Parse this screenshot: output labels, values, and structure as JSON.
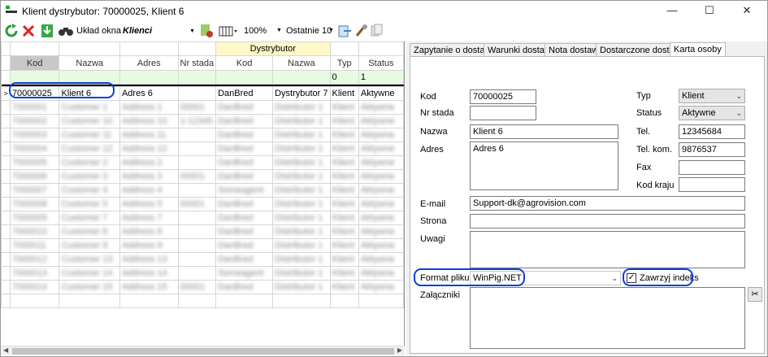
{
  "window": {
    "title": "Klient dystrybutor: 70000025, Klient 6",
    "minimize": "—",
    "maximize": "☐",
    "close": "✕"
  },
  "toolbar": {
    "layout_label": "Układ okna",
    "layout_value": "Klienci",
    "zoom": "100%",
    "recent": "Ostatnie 10"
  },
  "grid": {
    "group_header": "Dystrybutor",
    "columns": [
      "Kod",
      "Nazwa",
      "Adres",
      "Nr stada",
      "Kod",
      "Nazwa",
      "Typ",
      "Status"
    ],
    "filter": [
      "",
      "",
      "",
      "",
      "",
      "",
      "0",
      "1"
    ],
    "selected_row": [
      "70000025",
      "Klient 6",
      "Adres 6",
      "",
      "DanBred",
      "Dystrybutor 7",
      "Klient",
      "Aktywne"
    ],
    "blurred_rows": [
      [
        "7000001",
        "Customer 1",
        "Address 1",
        "00001",
        "DanBred",
        "Distributor 1",
        "Klient",
        "Aktywne"
      ],
      [
        "7000002",
        "Customer 10",
        "Address 10",
        "1-12345",
        "DanBred",
        "Distributor 1",
        "Klient",
        "Aktywne"
      ],
      [
        "7000003",
        "Customer 11",
        "Address 11",
        "",
        "DanBred",
        "Distributor 1",
        "Klient",
        "Aktywne"
      ],
      [
        "7000004",
        "Customer 12",
        "Address 12",
        "",
        "DanBred",
        "Distributor 1",
        "Klient",
        "Aktywne"
      ],
      [
        "7000005",
        "Customer 2",
        "Address 2",
        "",
        "DanBred",
        "Distributor 1",
        "Klient",
        "Aktywne"
      ],
      [
        "7000006",
        "Customer 3",
        "Address 3",
        "00001",
        "DanBred",
        "Distributor 1",
        "Klient",
        "Aktywne"
      ],
      [
        "7000007",
        "Customer 4",
        "Address 4",
        "",
        "Someagent",
        "Distributor 1",
        "Klient",
        "Aktywne"
      ],
      [
        "7000008",
        "Customer 5",
        "Address 5",
        "00001",
        "DanBred",
        "Distributor 1",
        "Klient",
        "Aktywne"
      ],
      [
        "7000009",
        "Customer 7",
        "Address 7",
        "",
        "DanBred",
        "Distributor 1",
        "Klient",
        "Aktywne"
      ],
      [
        "7000010",
        "Customer 8",
        "Address 8",
        "",
        "DanBred",
        "Distributor 1",
        "Klient",
        "Aktywne"
      ],
      [
        "7000011",
        "Customer 9",
        "Address 9",
        "",
        "DanBred",
        "Distributor 1",
        "Klient",
        "Aktywne"
      ],
      [
        "7000012",
        "Customer 13",
        "Address 13",
        "",
        "DanBred",
        "Distributor 1",
        "Klient",
        "Aktywne"
      ],
      [
        "7000013",
        "Customer 14",
        "Address 14",
        "",
        "Someagent",
        "Distributor 1",
        "Klient",
        "Aktywne"
      ],
      [
        "7000014",
        "Customer 15",
        "Address 15",
        "00001",
        "DanBred",
        "Distributor 1",
        "Klient",
        "Aktywne"
      ]
    ]
  },
  "tabs": [
    "Zapytanie o dostawę",
    "Warunki dostawy",
    "Nota dostawy",
    "Dostarczone dostawy",
    "Karta osoby"
  ],
  "form": {
    "kod_label": "Kod",
    "kod_value": "70000025",
    "nr_stada_label": "Nr stada",
    "nr_stada_value": "",
    "nazwa_label": "Nazwa",
    "nazwa_value": "Klient 6",
    "adres_label": "Adres",
    "adres_value": "Adres 6",
    "typ_label": "Typ",
    "typ_value": "Klient",
    "status_label": "Status",
    "status_value": "Aktywne",
    "tel_label": "Tel.",
    "tel_value": "12345684",
    "tel_kom_label": "Tel. kom.",
    "tel_kom_value": "9876537",
    "fax_label": "Fax",
    "fax_value": "",
    "kod_kraju_label": "Kod kraju",
    "kod_kraju_value": "",
    "email_label": "E-mail",
    "email_value": "Support-dk@agrovision.com",
    "strona_label": "Strona",
    "strona_value": "",
    "uwagi_label": "Uwagi",
    "uwagi_value": "",
    "format_label": "Format pliku",
    "format_value": "WinPig.NET",
    "zawrzyj_label": "Zawrzyj indeks",
    "zawrzyj_checked": "✓",
    "zalaczniki_label": "Załączniki"
  },
  "colors": {
    "highlight": "#0a3fd8",
    "filter_row": "#e6fbe0"
  }
}
